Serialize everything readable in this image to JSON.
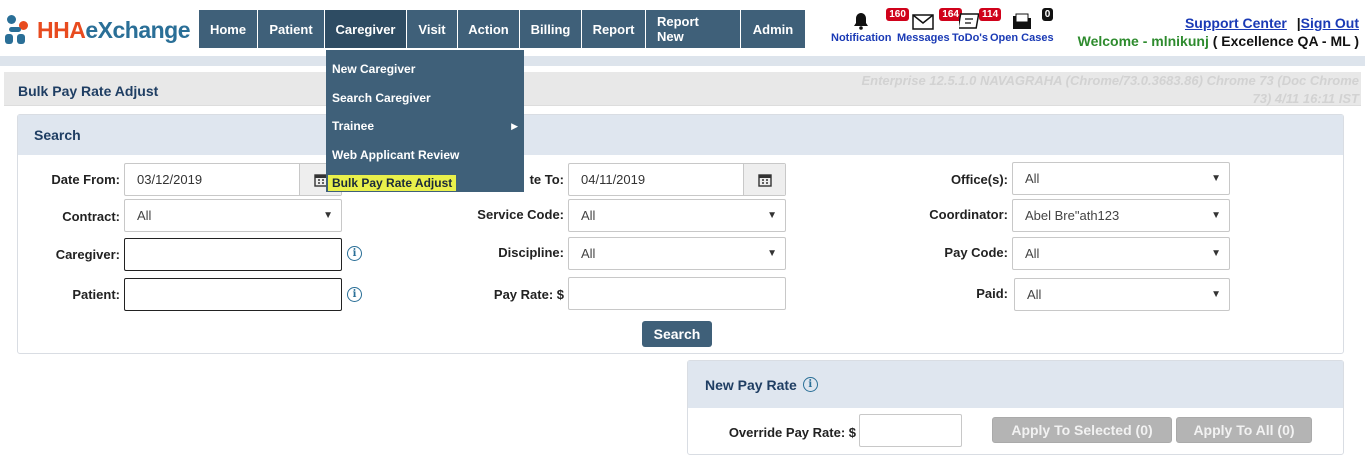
{
  "brand": {
    "part1": "HHA",
    "part2": "eXchange"
  },
  "nav": [
    {
      "label": "Home",
      "name": "nav-home"
    },
    {
      "label": "Patient",
      "name": "nav-patient"
    },
    {
      "label": "Caregiver",
      "name": "nav-caregiver"
    },
    {
      "label": "Visit",
      "name": "nav-visit"
    },
    {
      "label": "Action",
      "name": "nav-action"
    },
    {
      "label": "Billing",
      "name": "nav-billing"
    },
    {
      "label": "Report",
      "name": "nav-report"
    },
    {
      "label": "Report New",
      "name": "nav-report-new"
    },
    {
      "label": "Admin",
      "name": "nav-admin"
    }
  ],
  "notifications": {
    "notification": {
      "label": "Notification",
      "count": "160"
    },
    "messages": {
      "label": "Messages",
      "count": "164"
    },
    "todos": {
      "label": "ToDo's",
      "count": "114"
    },
    "open_cases": {
      "label": "Open Cases",
      "count": "0"
    }
  },
  "toplinks": {
    "support": "Support Center",
    "separator": "|",
    "signout": "Sign Out"
  },
  "welcome": {
    "prefix": "Welcome - mlnikunj",
    "account": "( Excellence QA - ML )"
  },
  "page_title": "Bulk Pay Rate Adjust",
  "version": {
    "line1": "Enterprise 12.5.1.0 NAVAGRAHA (Chrome/73.0.3683.86) Chrome 73 (Doc Chrome",
    "line2": "73) 4/11 16:11 IST"
  },
  "dropdown": [
    {
      "label": "New Caregiver",
      "submenu": false
    },
    {
      "label": "Search Caregiver",
      "submenu": false
    },
    {
      "label": "Trainee",
      "submenu": true
    },
    {
      "label": "Web Applicant Review",
      "submenu": false
    },
    {
      "label": "Bulk Pay Rate Adjust",
      "submenu": false,
      "highlighted": true
    }
  ],
  "search": {
    "title": "Search",
    "date_from_label": "Date From:",
    "date_from_value": "03/12/2019",
    "date_to_label": "te To:",
    "date_to_value": "04/11/2019",
    "offices_label": "Office(s):",
    "offices_value": "All",
    "contract_label": "Contract:",
    "contract_value": "All",
    "service_code_label": "Service Code:",
    "service_code_value": "All",
    "coordinator_label": "Coordinator:",
    "coordinator_value": "Abel Bre\"ath123",
    "caregiver_label": "Caregiver:",
    "caregiver_value": "",
    "discipline_label": "Discipline:",
    "discipline_value": "All",
    "pay_code_label": "Pay Code:",
    "pay_code_value": "All",
    "patient_label": "Patient:",
    "patient_value": "",
    "pay_rate_label": "Pay Rate: $",
    "pay_rate_value": "",
    "paid_label": "Paid:",
    "paid_value": "All",
    "button": "Search"
  },
  "new_pay_rate": {
    "title": "New Pay Rate",
    "override_label": "Override Pay Rate: $",
    "override_value": "",
    "apply_selected": "Apply To Selected (0)",
    "apply_all": "Apply To All (0)"
  },
  "colors": {
    "nav_bg": "#3f6079",
    "brand_orange": "#e84b1f",
    "brand_blue": "#2a6f97",
    "badge_red": "#d0021b",
    "highlight": "#e9f04b"
  }
}
